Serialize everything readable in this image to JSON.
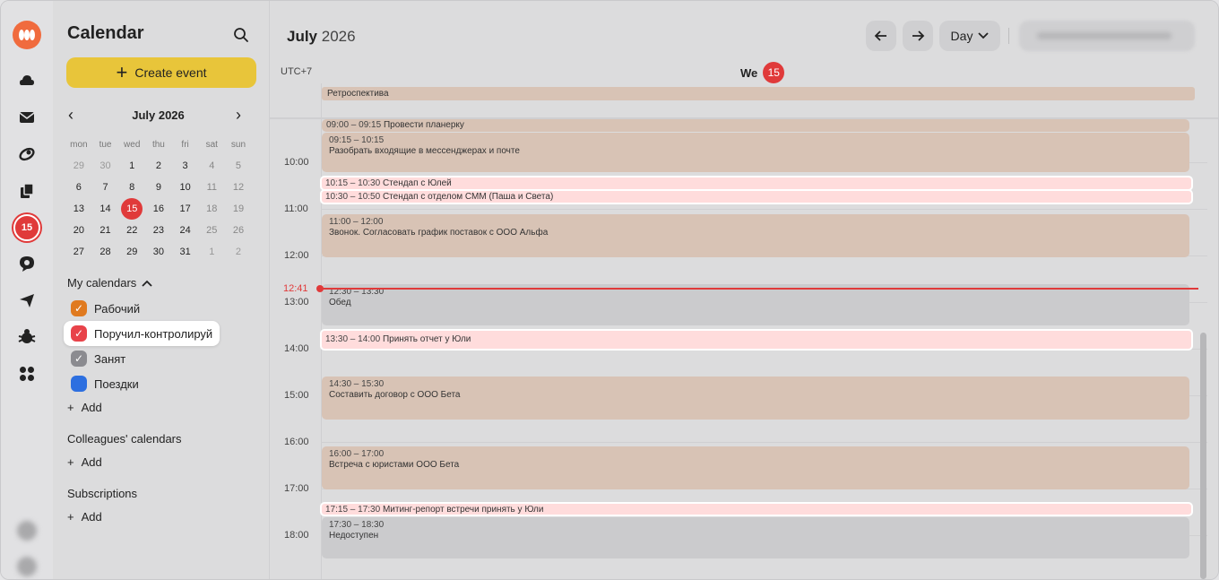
{
  "rail": {
    "items": [
      "logo-icon",
      "cloud-icon",
      "mail-icon",
      "disk-icon",
      "docs-icon",
      "calendar-icon",
      "messenger-icon",
      "telemost-icon",
      "bug-icon",
      "apps-icon"
    ],
    "calendar_badge": "15"
  },
  "sidebar": {
    "title": "Calendar",
    "create_label": "Create event",
    "mini_month": "July 2026",
    "dow": [
      "mon",
      "tue",
      "wed",
      "thu",
      "fri",
      "sat",
      "sun"
    ],
    "weeks": [
      [
        "29",
        "30",
        "1",
        "2",
        "3",
        "4",
        "5"
      ],
      [
        "6",
        "7",
        "8",
        "9",
        "10",
        "11",
        "12"
      ],
      [
        "13",
        "14",
        "15",
        "16",
        "17",
        "18",
        "19"
      ],
      [
        "20",
        "21",
        "22",
        "23",
        "24",
        "25",
        "26"
      ],
      [
        "27",
        "28",
        "29",
        "30",
        "31",
        "1",
        "2"
      ]
    ],
    "my_calendars_label": "My calendars",
    "calendars": [
      {
        "label": "Рабочий",
        "color": "#e07a1f"
      },
      {
        "label": "Поручил-контролируй",
        "color": "#e8434a"
      },
      {
        "label": "Занят",
        "color": "#8b8b90"
      },
      {
        "label": "Поездки",
        "color": "#2d6fe0"
      }
    ],
    "add_label": "Add",
    "colleagues_label": "Colleagues' calendars",
    "subscriptions_label": "Subscriptions"
  },
  "main": {
    "month": "July",
    "year": "2026",
    "view": "Day",
    "timezone": "UTC+7",
    "day_name": "We",
    "day_num": "15",
    "allday_event": "Ретроспектива",
    "hours": [
      "10:00",
      "11:00",
      "12:00",
      "13:00",
      "14:00",
      "15:00",
      "16:00",
      "17:00",
      "18:00"
    ],
    "now": "12:41",
    "events": [
      {
        "time": "09:00 – 09:15",
        "title": "Провести планерку",
        "kind": "tan-inline"
      },
      {
        "time": "09:15 – 10:15",
        "title": "Разобрать входящие в мессенджерах и почте",
        "kind": "tan"
      },
      {
        "time": "10:15 – 10:30",
        "title": "Стендап с Юлей",
        "kind": "pink"
      },
      {
        "time": "10:30 – 10:50",
        "title": "Стендап с отделом СММ (Паша и Света)",
        "kind": "pink"
      },
      {
        "time": "11:00 – 12:00",
        "title": "Звонок. Согласовать график поставок с ООО Альфа",
        "kind": "tan"
      },
      {
        "time": "12:30 – 13:30",
        "title": "Обед",
        "kind": "gray"
      },
      {
        "time": "13:30 – 14:00",
        "title": "Принять отчет у Юли",
        "kind": "pink"
      },
      {
        "time": "14:30 – 15:30",
        "title": "Составить договор с ООО Бета",
        "kind": "tan"
      },
      {
        "time": "16:00 – 17:00",
        "title": "Встреча с юристами ООО Бета",
        "kind": "tan"
      },
      {
        "time": "17:15 – 17:30",
        "title": "Митинг-репорт встречи принять у Юли",
        "kind": "pink"
      },
      {
        "time": "17:30 – 18:30",
        "title": "Недоступен",
        "kind": "gray"
      }
    ]
  },
  "colors": {
    "accent_yellow": "#e8c53a",
    "today_red": "#e03a3a",
    "event_tan": "#d8c3b5",
    "event_pink": "#ffdcdc",
    "event_gray": "#cbcbcd"
  }
}
